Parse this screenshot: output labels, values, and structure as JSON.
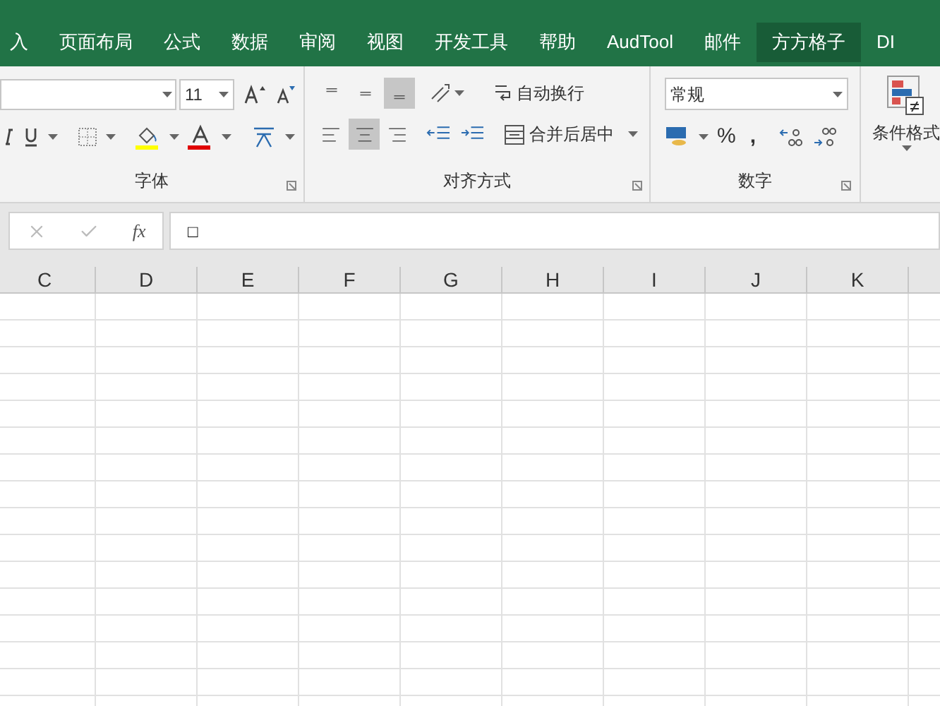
{
  "tabs": [
    {
      "label": "入",
      "selected": false
    },
    {
      "label": "页面布局",
      "selected": false
    },
    {
      "label": "公式",
      "selected": false
    },
    {
      "label": "数据",
      "selected": false
    },
    {
      "label": "审阅",
      "selected": false
    },
    {
      "label": "视图",
      "selected": false
    },
    {
      "label": "开发工具",
      "selected": false
    },
    {
      "label": "帮助",
      "selected": false
    },
    {
      "label": "AudTool",
      "selected": false
    },
    {
      "label": "邮件",
      "selected": false
    },
    {
      "label": "方方格子",
      "selected": true
    },
    {
      "label": "DI",
      "selected": false
    }
  ],
  "ribbon": {
    "font": {
      "label": "字体",
      "size": "11"
    },
    "alignment": {
      "label": "对齐方式",
      "vertical": [
        {
          "selected": false
        },
        {
          "selected": false
        },
        {
          "selected": true
        }
      ],
      "horizontal": [
        {
          "selected": false
        },
        {
          "selected": true
        },
        {
          "selected": false
        }
      ],
      "wrap_text": "自动换行",
      "merge": "合并后居中"
    },
    "number": {
      "label": "数字",
      "format": "常规",
      "percent": "%",
      "comma": ","
    },
    "styles": {
      "conditional_format": "条件格式"
    }
  },
  "formula_bar": {
    "fx": "fx",
    "value": "□"
  },
  "columns": [
    "C",
    "D",
    "E",
    "F",
    "G",
    "H",
    "I",
    "J",
    "K"
  ]
}
